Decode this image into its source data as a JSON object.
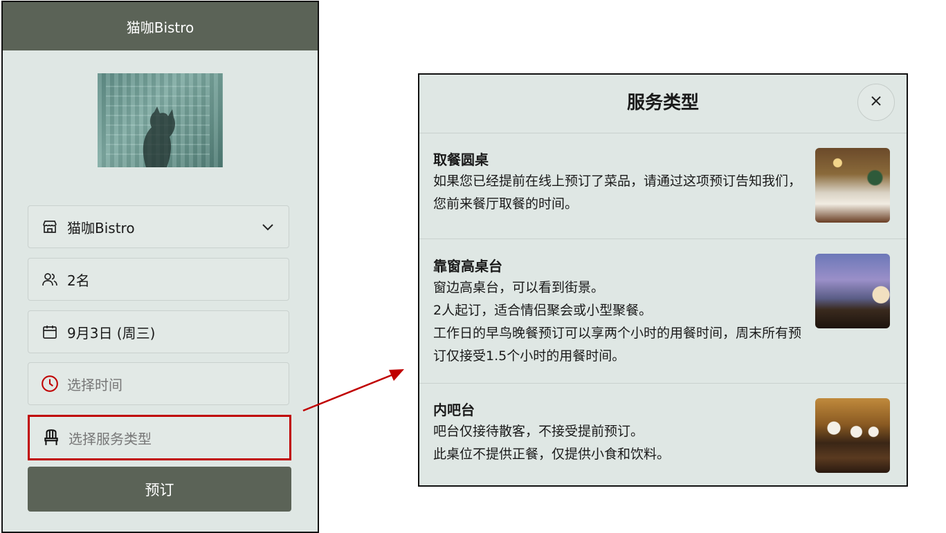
{
  "app": {
    "header_title": "猫咖Bistro"
  },
  "form": {
    "restaurant": "猫咖Bistro",
    "guests": "2名",
    "date": "9月3日 (周三)",
    "time_placeholder": "选择时间",
    "service_placeholder": "选择服务类型",
    "book_label": "预订"
  },
  "colors": {
    "accent": "#5b6357",
    "highlight": "#c00000",
    "background": "#dfe7e4"
  },
  "modal": {
    "title": "服务类型",
    "options": [
      {
        "title": "取餐圆桌",
        "lines": [
          "如果您已经提前在线上预订了菜品，请通过这项预订告知我们，您前来餐厅取餐的时间。"
        ]
      },
      {
        "title": "靠窗高桌台",
        "lines": [
          "窗边高桌台，可以看到街景。",
          "2人起订，适合情侣聚会或小型聚餐。",
          "工作日的早鸟晚餐预订可以享两个小时的用餐时间，周末所有预订仅接受1.5个小时的用餐时间。"
        ]
      },
      {
        "title": "内吧台",
        "lines": [
          "吧台仅接待散客，不接受提前预订。",
          "此桌位不提供正餐，仅提供小食和饮料。"
        ]
      }
    ]
  },
  "icons": {
    "restaurant": "store-icon",
    "guests": "users-icon",
    "date": "calendar-icon",
    "time": "clock-icon",
    "service": "chair-icon",
    "close": "close-icon",
    "dropdown": "chevron-down-icon"
  }
}
